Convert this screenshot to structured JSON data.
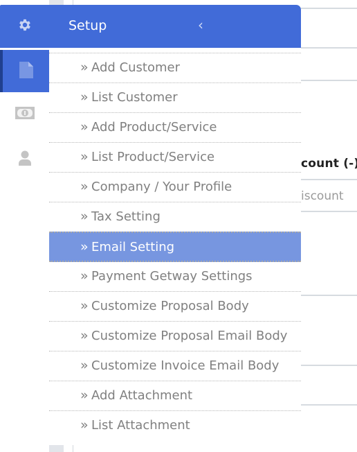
{
  "sidebar": {
    "rail": [
      {
        "icon": "gear-icon",
        "label": "Setup"
      },
      {
        "icon": "document-icon",
        "label": "Documents",
        "active": true
      },
      {
        "icon": "money-icon",
        "label": "Payments"
      },
      {
        "icon": "user-icon",
        "label": "Users"
      }
    ],
    "header": {
      "title": "Setup",
      "collapse_glyph": "‹"
    },
    "chevron_glyph": "»",
    "items": [
      {
        "label": "Add Customer"
      },
      {
        "label": "List Customer"
      },
      {
        "label": "Add Product/Service"
      },
      {
        "label": "List Product/Service"
      },
      {
        "label": "Company / Your Profile"
      },
      {
        "label": "Tax Setting"
      },
      {
        "label": "Email Setting",
        "active": true
      },
      {
        "label": "Payment Getway Settings"
      },
      {
        "label": "Customize Proposal Body"
      },
      {
        "label": "Customize Proposal Email Body"
      },
      {
        "label": "Customize Invoice Email Body"
      },
      {
        "label": "Add Attachment"
      },
      {
        "label": "List Attachment"
      }
    ]
  },
  "background": {
    "column_heading": "count (-)",
    "column_sub": "iscount"
  },
  "colors": {
    "primary": "#416bd8",
    "active_item": "#7796e0",
    "rail_indicator": "#20408f",
    "menu_text": "#808080"
  }
}
